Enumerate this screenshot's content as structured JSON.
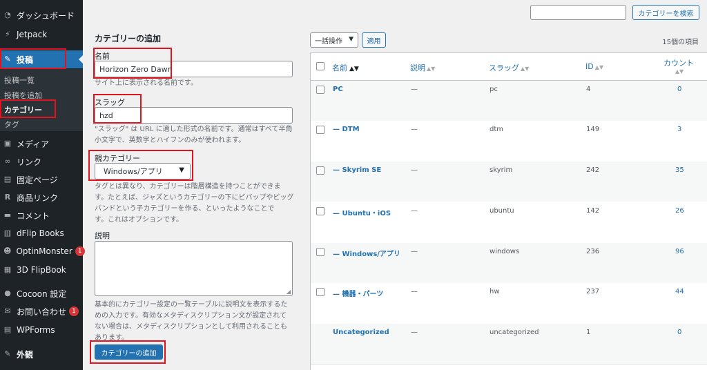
{
  "sidebar": {
    "menu": [
      {
        "label": "ダッシュボード",
        "icon": "dashboard-icon"
      },
      {
        "label": "Jetpack",
        "icon": "jetpack-icon"
      },
      {
        "label": "投稿",
        "icon": "pin-icon"
      },
      {
        "label": "メディア",
        "icon": "media-icon"
      },
      {
        "label": "リンク",
        "icon": "link-icon"
      },
      {
        "label": "固定ページ",
        "icon": "page-icon"
      },
      {
        "label": "商品リンク",
        "icon": "product-icon"
      },
      {
        "label": "コメント",
        "icon": "comment-icon"
      },
      {
        "label": "dFlip Books",
        "icon": "book-icon"
      },
      {
        "label": "OptinMonster",
        "icon": "monster-icon",
        "badge": "1"
      },
      {
        "label": "3D FlipBook",
        "icon": "flipbook-icon"
      },
      {
        "label": "Cocoon 設定",
        "icon": "cocoon-icon"
      },
      {
        "label": "お問い合わせ",
        "icon": "mail-icon",
        "badge": "1"
      },
      {
        "label": "WPForms",
        "icon": "forms-icon"
      },
      {
        "label": "外観",
        "icon": "brush-icon"
      }
    ],
    "submenu": [
      "投稿一覧",
      "投稿を追加",
      "カテゴリー",
      "タグ"
    ]
  },
  "form": {
    "title": "カテゴリーの追加",
    "name_label": "名前",
    "name_value": "Horizon Zero Dawn",
    "name_help": "サイト上に表示される名前です。",
    "slug_label": "スラッグ",
    "slug_value": "hzd",
    "slug_help_1": "\"スラッグ\" は URL に適した形式の名前です。通常はすべて半角",
    "slug_help_2": "小文字で、英数字とハイフンのみが使われます。",
    "parent_label": "親カテゴリー",
    "parent_value": "Windows/アプリ",
    "parent_help_1": "タグとは異なり、カテゴリーは階層構造を持つことができま",
    "parent_help_2": "す。たとえば、ジャズというカテゴリーの下にビバップやビッグ",
    "parent_help_3": "バンドという子カテゴリーを作る、といったようなことで",
    "parent_help_4": "す。これはオプションです。",
    "desc_label": "説明",
    "desc_help_1": "基本的にカテゴリー設定の一覧テーブルに説明文を表示するた",
    "desc_help_2": "めの入力です。有効なメタディスクリプション文が設定されて",
    "desc_help_3": "ない場合は、メタディスクリプションとして利用されることも",
    "desc_help_4": "あります。",
    "submit_label": "カテゴリーの追加"
  },
  "search": {
    "button_label": "カテゴリーを検索"
  },
  "bulk": {
    "select_label": "一括操作",
    "apply_label": "適用",
    "item_count": "15個の項目"
  },
  "table": {
    "headers": {
      "name": "名前",
      "description": "説明",
      "slug": "スラッグ",
      "id": "ID",
      "count": "カウント"
    },
    "rows": [
      {
        "name": "PC",
        "description": "—",
        "slug": "pc",
        "id": "4",
        "count": "0"
      },
      {
        "name": "— DTM",
        "description": "—",
        "slug": "dtm",
        "id": "149",
        "count": "3"
      },
      {
        "name": "— Skyrim SE",
        "description": "—",
        "slug": "skyrim",
        "id": "242",
        "count": "35"
      },
      {
        "name": "— Ubuntu・iOS",
        "description": "—",
        "slug": "ubuntu",
        "id": "142",
        "count": "26"
      },
      {
        "name": "— Windows/アプリ",
        "description": "—",
        "slug": "windows",
        "id": "236",
        "count": "96"
      },
      {
        "name": "— 機器・パーツ",
        "description": "—",
        "slug": "hw",
        "id": "237",
        "count": "44"
      },
      {
        "name": "Uncategorized",
        "description": "—",
        "slug": "uncategorized",
        "id": "1",
        "count": "0"
      }
    ]
  },
  "colors": {
    "accent": "#2271b1",
    "sidebar_bg": "#1d2327",
    "highlight": "#e0141e"
  }
}
